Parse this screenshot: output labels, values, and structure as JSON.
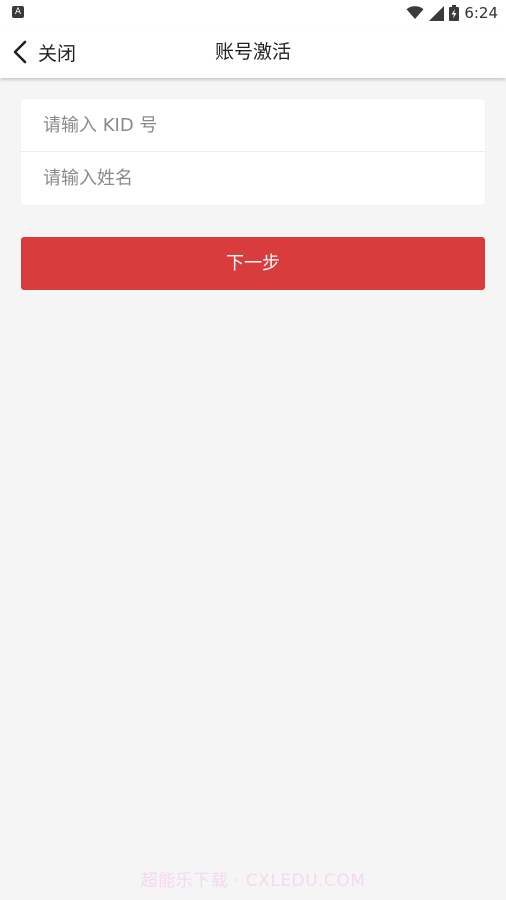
{
  "status_bar": {
    "time": "6:24",
    "left_icon_name": "keyboard-a-icon",
    "left_icon_glyph": "A"
  },
  "app_bar": {
    "back_label": "关闭",
    "title": "账号激活"
  },
  "form": {
    "kid_placeholder": "请输入 KID 号",
    "kid_value": "",
    "name_placeholder": "请输入姓名",
    "name_value": ""
  },
  "actions": {
    "next_label": "下一步"
  },
  "colors": {
    "accent": "#d93c3c",
    "background": "#f5f5f5",
    "card": "#ffffff"
  },
  "watermark": {
    "text": "超能乐下载 · CXLEDU.COM"
  }
}
